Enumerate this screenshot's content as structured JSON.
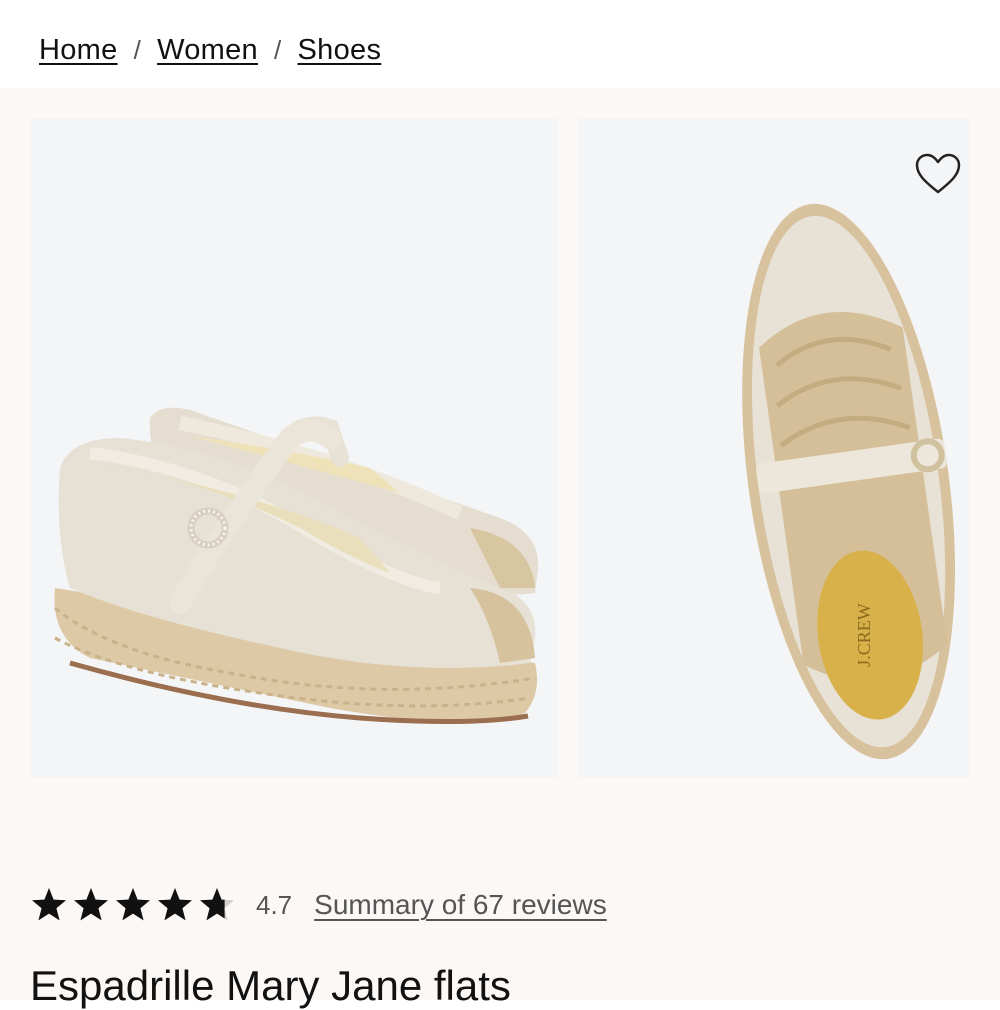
{
  "breadcrumb": {
    "items": [
      "Home",
      "Women",
      "Shoes"
    ],
    "separator": "/"
  },
  "gallery": {
    "images": [
      {
        "alt": "Espadrille Mary Jane flats pair, side view"
      },
      {
        "alt": "Espadrille Mary Jane flat, top view",
        "insole_brand": "J.CREW"
      }
    ],
    "wishlist_icon": "heart-outline-icon"
  },
  "rating": {
    "value": 4.7,
    "value_text": "4.7",
    "max_stars": 5,
    "reviews_link": "Summary of 67 reviews"
  },
  "product": {
    "title": "Espadrille Mary Jane flats"
  },
  "colors": {
    "gallery_bg": "#fbf8f6",
    "image_bg": "#f4f5f7",
    "text": "#111111",
    "muted_text": "#555555"
  }
}
